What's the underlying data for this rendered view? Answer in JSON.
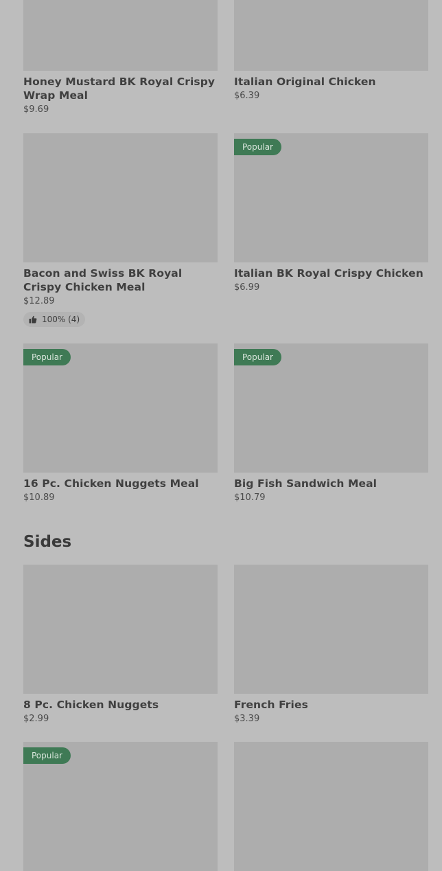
{
  "items": [
    {
      "name": "Honey Mustard BK Royal Crispy Wrap Meal",
      "price": "$9.69"
    },
    {
      "name": "Italian Original Chicken",
      "price": "$6.39"
    },
    {
      "name": "Bacon and Swiss BK Royal Crispy Chicken Meal",
      "price": "$12.89",
      "rating": "100% (4)"
    },
    {
      "name": "Italian BK Royal Crispy Chicken",
      "price": "$6.99",
      "badge": "Popular"
    },
    {
      "name": "16 Pc. Chicken Nuggets Meal",
      "price": "$10.89",
      "badge": "Popular"
    },
    {
      "name": "Big Fish Sandwich Meal",
      "price": "$10.79",
      "badge": "Popular"
    }
  ],
  "sides": {
    "title": "Sides",
    "items": [
      {
        "name": "8 Pc. Chicken Nuggets",
        "price": "$2.99"
      },
      {
        "name": "French Fries",
        "price": "$3.39"
      },
      {
        "badge": "Popular"
      },
      {}
    ]
  },
  "colors": {
    "background": "#bdbdbd",
    "image_placeholder": "#adadad",
    "popular_badge": "#3f7a55"
  },
  "icons": {
    "rating": "thumbs-up-icon"
  }
}
